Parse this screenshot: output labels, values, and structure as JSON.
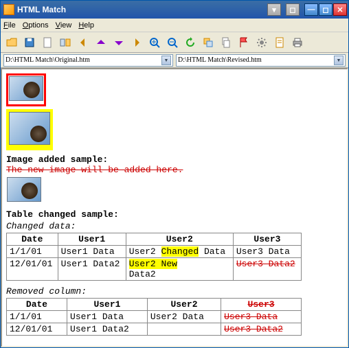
{
  "window": {
    "title": "HTML Match"
  },
  "menubar": {
    "file": "File",
    "options": "Options",
    "view": "View",
    "help": "Help"
  },
  "paths": {
    "left": "D:\\HTML Match\\Original.htm",
    "right": "D:\\HTML Match\\Revised.htm"
  },
  "sections": {
    "image_added": "Image added sample:",
    "image_added_strike": "The new image will be added here.",
    "table_changed": "Table changed sample:",
    "changed_data": "Changed data:",
    "removed_col": "Removed column:"
  },
  "table1": {
    "headers": [
      "Date",
      "User1",
      "User2",
      "User3"
    ],
    "rows": [
      {
        "c0": "1/1/01",
        "c1": "User1 Data",
        "c2_pre": "User2 ",
        "c2_hl": "Changed",
        "c2_post": " Data",
        "c3": "User3 Data"
      },
      {
        "c0": "12/01/01",
        "c1": "User1 Data2",
        "c2_line1_hl": "User2  New",
        "c2_line2": "Data2",
        "c3_strike": "User3 Data2"
      }
    ]
  },
  "table2": {
    "h0": "Date",
    "h1": "User1",
    "h2": "User2",
    "h3_strike": "User3",
    "rows": [
      {
        "c0": "1/1/01",
        "c1": "User1 Data",
        "c2": "User2  Data",
        "c3_strike": "User3 Data"
      },
      {
        "c0": "12/01/01",
        "c1": "User1 Data2",
        "c2": "",
        "c3_strike": "User3 Data2"
      }
    ]
  },
  "icons": {
    "toolbar": [
      "open-icon",
      "save-icon",
      "page-icon",
      "compare-icon",
      "arrow-left-icon",
      "arrow-up-icon",
      "arrow-down-icon",
      "arrow-right-icon",
      "zoom-in-icon",
      "zoom-out-icon",
      "refresh-icon",
      "overlay-icon",
      "copy-icon",
      "flag-icon",
      "settings-icon",
      "document-icon",
      "print-icon"
    ]
  }
}
